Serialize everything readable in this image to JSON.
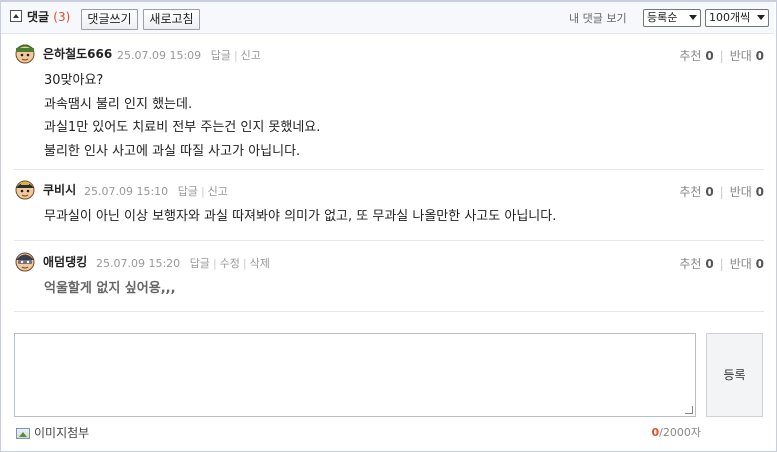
{
  "header": {
    "title": "댓글",
    "count": "(3)",
    "write_button": "댓글쓰기",
    "refresh_button": "새로고침",
    "my_comments": "내 댓글 보기",
    "sort_select": "등록순",
    "page_size_select": "100개씩"
  },
  "comments": [
    {
      "nick": "은하철도666",
      "date": "25.07.09 15:09",
      "actions": [
        "답글",
        "신고"
      ],
      "recommend_label": "추천",
      "recommend": "0",
      "oppose_label": "반대",
      "oppose": "0",
      "lines": [
        "30맞아요?",
        "과속땜시 불리 인지 했는데.",
        "과실1만 있어도 치료비 전부 주는건 인지 못했네요.",
        "불리한 인사 사고에 과실 따질 사고가 아닙니다."
      ]
    },
    {
      "nick": "쿠비시",
      "date": "25.07.09 15:10",
      "actions": [
        "답글",
        "신고"
      ],
      "recommend_label": "추천",
      "recommend": "0",
      "oppose_label": "반대",
      "oppose": "0",
      "lines": [
        "무과실이 아닌 이상 보행자와 과실 따져봐야 의미가 없고, 또 무과실 나올만한 사고도 아닙니다."
      ]
    },
    {
      "nick": "애덤댕킹",
      "date": "25.07.09 15:20",
      "actions": [
        "답글",
        "수정",
        "삭제"
      ],
      "recommend_label": "추천",
      "recommend": "0",
      "oppose_label": "반대",
      "oppose": "0",
      "lines": [
        "억울할게 없지 싶어용,,,"
      ]
    }
  ],
  "editor": {
    "submit_button": "등록",
    "attach_image": "이미지첨부",
    "char_count": "0",
    "char_limit": "/2000자"
  },
  "colors": {
    "accent": "#e0502a",
    "border": "#c8cde0",
    "header_bg": "#f7f8fb"
  }
}
